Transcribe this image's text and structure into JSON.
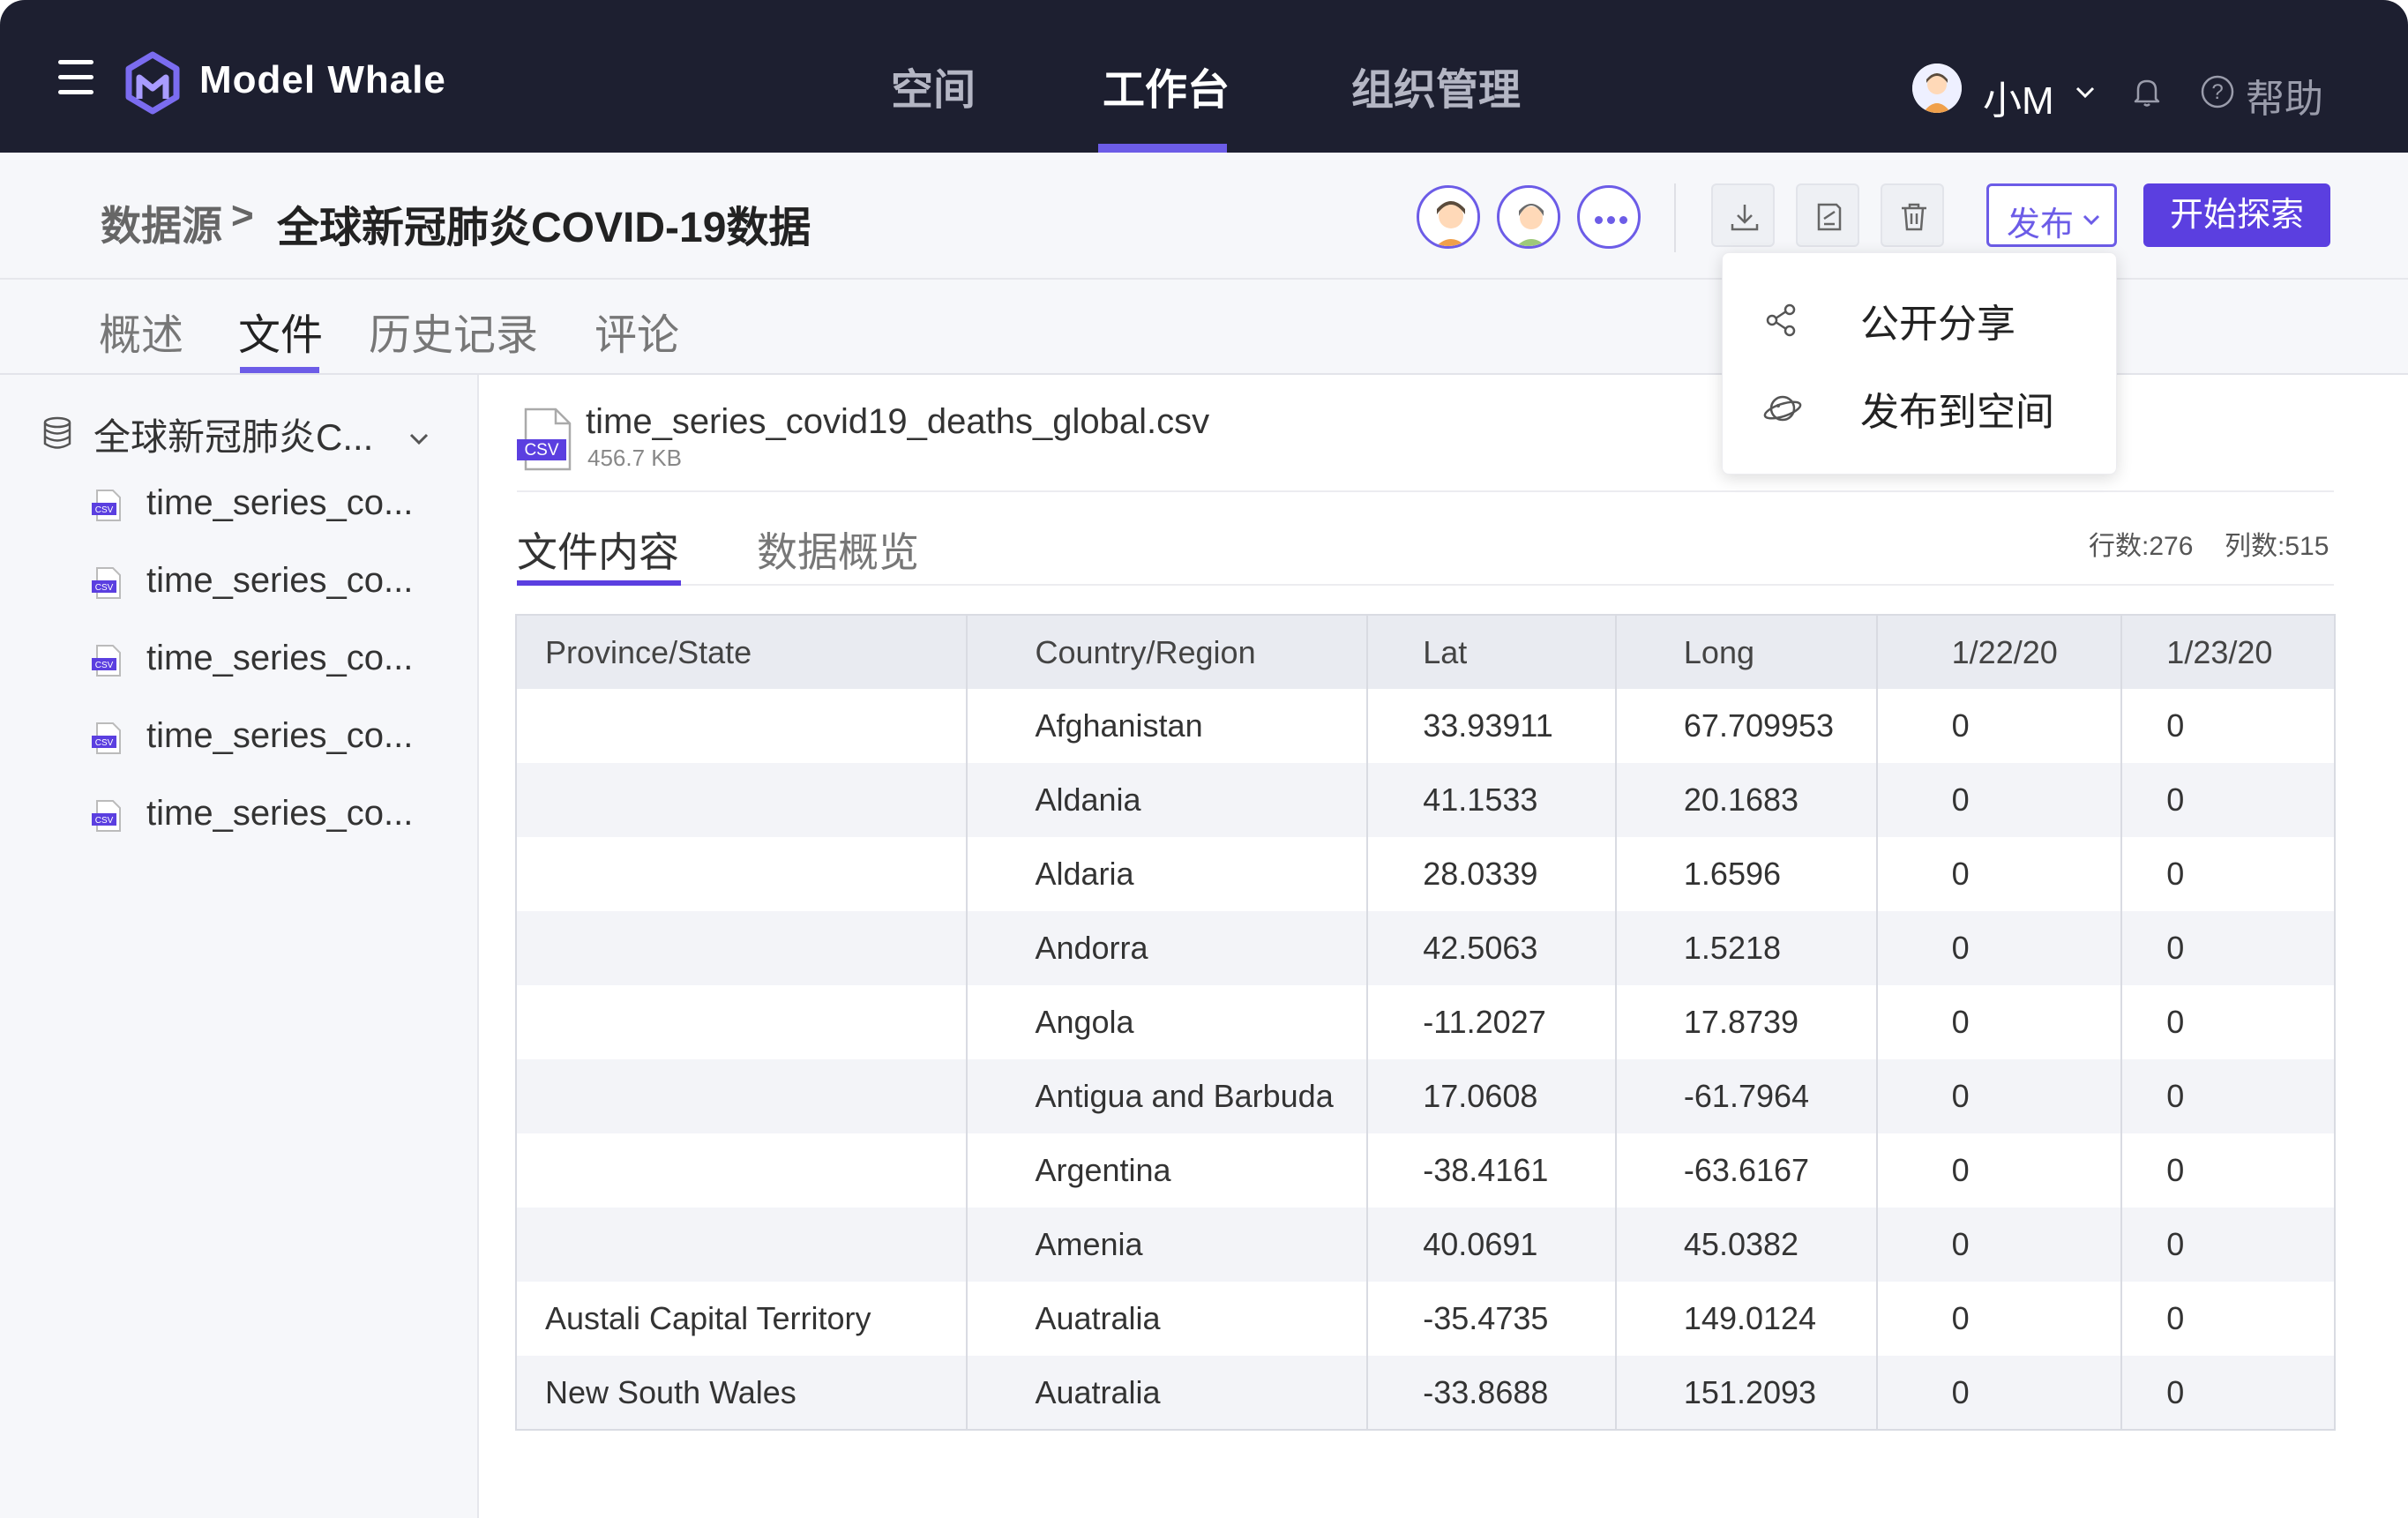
{
  "nav": {
    "logo_text": "Model Whale",
    "items": [
      {
        "label": "空间"
      },
      {
        "label": "工作台"
      },
      {
        "label": "组织管理"
      }
    ],
    "user_name": "小M",
    "help_label": "帮助",
    "accent_color": "#6c5ce7",
    "bg_color": "#1d1f30"
  },
  "header": {
    "breadcrumb_root": "数据源",
    "breadcrumb_sep": ">",
    "title": "全球新冠肺炎COVID-19数据",
    "publish_label": "发布",
    "explore_label": "开始探索",
    "icons": [
      "download-icon",
      "edit-icon",
      "trash-icon"
    ]
  },
  "publish_menu": {
    "items": [
      {
        "label": "公开分享",
        "icon": "share-icon"
      },
      {
        "label": "发布到空间",
        "icon": "planet-icon"
      }
    ]
  },
  "tabs": [
    {
      "label": "概述"
    },
    {
      "label": "文件"
    },
    {
      "label": "历史记录"
    },
    {
      "label": "评论"
    }
  ],
  "sidebar": {
    "dataset_name": "全球新冠肺炎C...",
    "files": [
      {
        "name": "time_series_co..."
      },
      {
        "name": "time_series_co..."
      },
      {
        "name": "time_series_co..."
      },
      {
        "name": "time_series_co..."
      },
      {
        "name": "time_series_co..."
      }
    ]
  },
  "file": {
    "badge": "CSV",
    "name": "time_series_covid19_deaths_global.csv",
    "size": "456.7 KB",
    "subtabs": [
      {
        "label": "文件内容"
      },
      {
        "label": "数据概览"
      }
    ],
    "rows_label": "行数:276",
    "cols_label": "列数:515"
  },
  "table": {
    "columns": [
      "Province/State",
      "Country/Region",
      "Lat",
      "Long",
      "1/22/20",
      "1/23/20"
    ],
    "rows": [
      [
        "",
        "Afghanistan",
        "33.93911",
        "67.709953",
        "0",
        "0"
      ],
      [
        "",
        "Aldania",
        "41.1533",
        "20.1683",
        "0",
        "0"
      ],
      [
        "",
        "Aldaria",
        "28.0339",
        "1.6596",
        "0",
        "0"
      ],
      [
        "",
        "Andorra",
        "42.5063",
        "1.5218",
        "0",
        "0"
      ],
      [
        "",
        "Angola",
        "-11.2027",
        "17.8739",
        "0",
        "0"
      ],
      [
        "",
        "Antigua and Barbuda",
        "17.0608",
        "-61.7964",
        "0",
        "0"
      ],
      [
        "",
        "Argentina",
        "-38.4161",
        "-63.6167",
        "0",
        "0"
      ],
      [
        "",
        "Amenia",
        "40.0691",
        "45.0382",
        "0",
        "0"
      ],
      [
        "Austali Capital Territory",
        "Auatralia",
        "-35.4735",
        "149.0124",
        "0",
        "0"
      ],
      [
        "New South Wales",
        "Auatralia",
        "-33.8688",
        "151.2093",
        "0",
        "0"
      ]
    ]
  }
}
